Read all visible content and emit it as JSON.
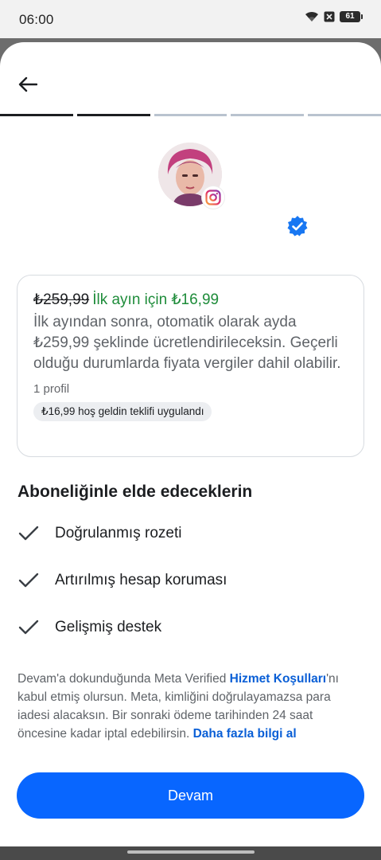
{
  "status_bar": {
    "time": "06:00",
    "battery": "61"
  },
  "header": {
    "back_icon": "arrow-left-icon",
    "progress_steps": 5,
    "progress_active": 2
  },
  "profile": {
    "platform_icon": "instagram-icon",
    "verified_icon": "verified-badge-icon",
    "verified_color": "#1877f2"
  },
  "offer": {
    "old_price": "₺259,99",
    "promo": "İlk ayın için ₺16,99",
    "description": "İlk ayından sonra, otomatik olarak ayda ₺259,99 şeklinde ücretlendirileceksin. Geçerli olduğu durumlarda fiyata vergiler dahil olabilir.",
    "profile_count": "1 profil",
    "welcome_chip": "₺16,99 hoş geldin teklifi uygulandı"
  },
  "benefits": {
    "title": "Aboneliğinle elde edeceklerin",
    "items": [
      {
        "label": "Doğrulanmış rozeti",
        "icon": "checkmark-icon"
      },
      {
        "label": "Artırılmış hesap koruması",
        "icon": "checkmark-icon"
      },
      {
        "label": "Gelişmiş destek",
        "icon": "checkmark-icon"
      }
    ]
  },
  "terms": {
    "text1": "Devam'a dokunduğunda Meta Verified ",
    "link1": "Hizmet Koşulları",
    "text2": "'nı kabul etmiş olursun. Meta, kimliğini doğrulayamazsa para iadesi alacaksın. Bir sonraki ödeme tarihinden 24 saat öncesine kadar iptal edebilirsin. ",
    "link2": "Daha fazla bilgi al"
  },
  "cta": {
    "label": "Devam",
    "color": "#0866ff"
  },
  "colors": {
    "promo_green": "#1e8c3a",
    "link_blue": "#0a5fd6"
  }
}
